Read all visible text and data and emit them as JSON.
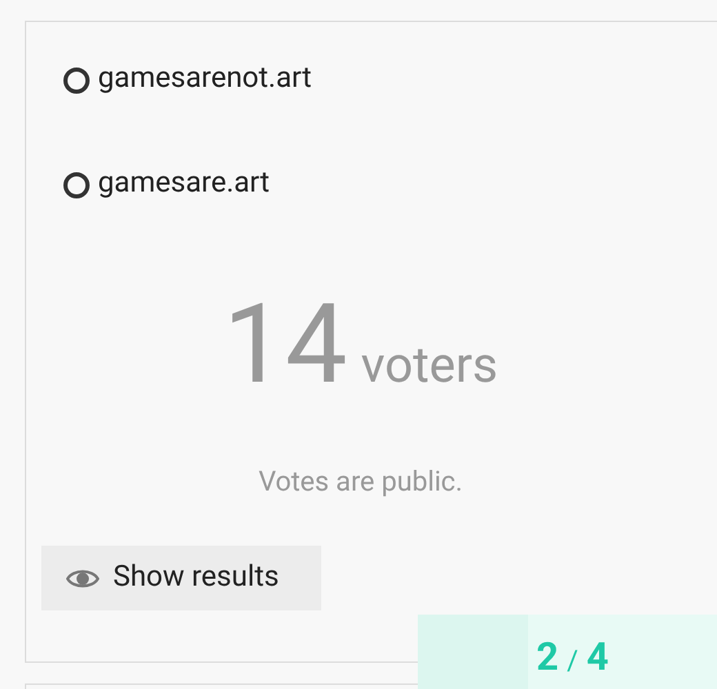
{
  "poll": {
    "options": [
      {
        "label": "gamesarenot.art",
        "selected": false
      },
      {
        "label": "gamesare.art",
        "selected": false
      }
    ],
    "voter_count": "14",
    "voter_label": "voters",
    "notice": "Votes are public.",
    "show_results_button": "Show results"
  },
  "progress": {
    "current": "2",
    "separator": "/",
    "total": "4",
    "level": 0.37
  }
}
